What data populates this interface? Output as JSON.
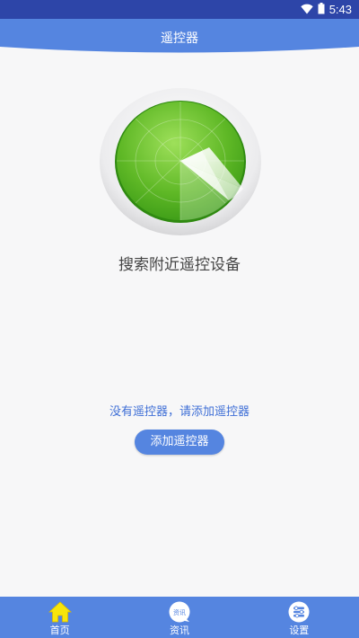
{
  "status_bar": {
    "time": "5:43",
    "icons": [
      "wifi-icon",
      "battery-icon"
    ]
  },
  "header": {
    "title": "遥控器"
  },
  "radar": {
    "icon": "radar-icon",
    "colors": {
      "outer": "#e3e3e5",
      "disc": "#6fc22d",
      "disc_dark": "#3e9d17",
      "sweep": "#ffffff"
    }
  },
  "main": {
    "search_label": "搜索附近遥控设备",
    "empty_message": "没有遥控器，请添加遥控器",
    "add_button_label": "添加遥控器"
  },
  "tabbar": {
    "items": [
      {
        "label": "首页",
        "icon": "home-icon",
        "active": true
      },
      {
        "label": "资讯",
        "icon": "news-icon",
        "icon_text": "资讯",
        "active": false
      },
      {
        "label": "设置",
        "icon": "settings-icon",
        "active": false
      }
    ]
  },
  "colors": {
    "primary": "#5585e0",
    "status_bar": "#2d45a8",
    "link_text": "#3f6fd6",
    "active_icon": "#f7e50a"
  }
}
